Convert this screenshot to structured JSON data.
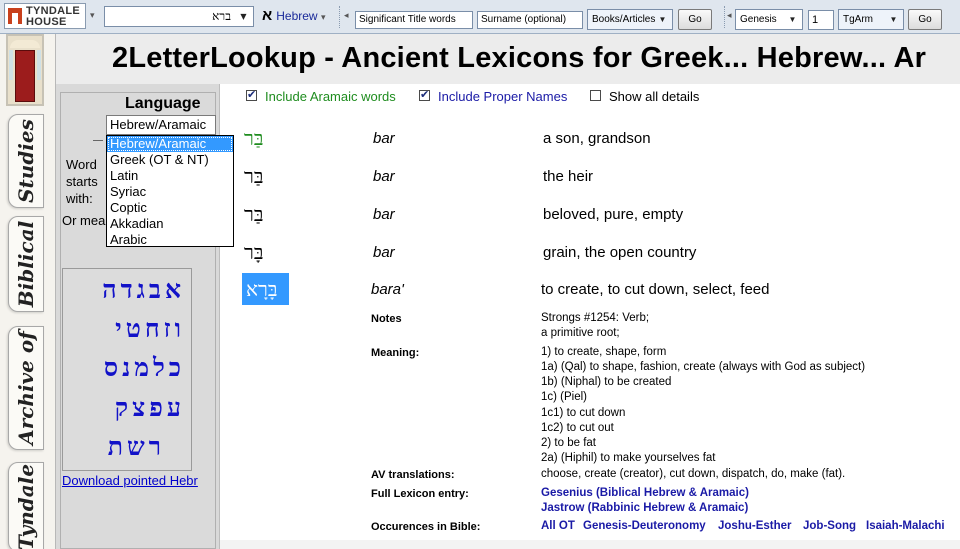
{
  "toolbar": {
    "logo_line1": "TYNDALE",
    "logo_line2": "HOUSE",
    "search_value": "ברא",
    "language_label": "Hebrew",
    "language_icon": "א",
    "title_words_placeholder": "Significant Title words",
    "surname_placeholder": "Surname (optional)",
    "books_select": "Books/Articles",
    "go_label": "Go",
    "book_select": "Genesis",
    "chapter_value": "1",
    "version_select": "TgArm",
    "go2_label": "Go"
  },
  "sidetabs": [
    "Studies",
    "Biblical",
    "Archive of",
    "Tyndale"
  ],
  "header": {
    "title": "2LetterLookup  -  Ancient Lexicons for Greek... Hebrew... Ar"
  },
  "leftpanel": {
    "language_label": "Language",
    "language_selected": "Hebrew/Aramaic",
    "language_options": [
      "Hebrew/Aramaic",
      "Greek (OT & NT)",
      "Latin",
      "Syriac",
      "Coptic",
      "Akkadian",
      "Arabic"
    ],
    "word_starts_line1": "Word",
    "word_starts_line2": "starts",
    "word_starts_line3": "with:",
    "or_means": "Or mea",
    "alefbet_rows": [
      "אבגדה",
      "וזחטי",
      "כלמנס",
      "עפצק",
      "רשת"
    ],
    "download_link": "Download pointed Hebr"
  },
  "options": {
    "aramaic_label": "Include Aramaic words",
    "aramaic_checked": true,
    "proper_names_label": "Include Proper Names",
    "proper_names_checked": true,
    "show_details_label": "Show all details",
    "show_details_checked": false
  },
  "entries": [
    {
      "hebrew": "בַּר",
      "translit": "bar",
      "gloss": "a son, grandson",
      "color": "#1e8c1e"
    },
    {
      "hebrew": "בַּר",
      "translit": "bar",
      "gloss": "the heir",
      "color": "#000000"
    },
    {
      "hebrew": "בַּר",
      "translit": "bar",
      "gloss": "beloved, pure, empty",
      "color": "#000000"
    },
    {
      "hebrew": "בָּר",
      "translit": "bar",
      "gloss": "grain, the open country",
      "color": "#000000"
    },
    {
      "hebrew": "בָּרָא",
      "translit": "bara'",
      "gloss": "to create, to cut down, select, feed",
      "color": "#ffffff"
    }
  ],
  "details": {
    "notes_label": "Notes",
    "notes": [
      "Strongs #1254: Verb;",
      "a primitive root;"
    ],
    "meaning_label": "Meaning:",
    "meaning": [
      "1) to create, shape, form",
      "1a) (Qal) to shape, fashion, create (always with God as subject)",
      "1b) (Niphal) to be created",
      "1c) (Piel)",
      "1c1) to cut down",
      "1c2) to cut out",
      "2) to be fat",
      "2a) (Hiphil) to make yourselves fat"
    ],
    "av_label": "AV translations:",
    "av": "choose, create (creator), cut down, dispatch, do, make (fat).",
    "lexicon_label": "Full Lexicon entry:",
    "lexicon_links": [
      "Gesenius (Biblical Hebrew & Aramaic)",
      "Jastrow (Rabbinic Hebrew & Aramaic)"
    ],
    "occurrences_label": "Occurences in Bible:",
    "occurrence_links": [
      "All OT",
      "Genesis-Deuteronomy",
      "Joshu-Esther",
      "Job-Song",
      "Isaiah-Malachi"
    ]
  },
  "colors": {
    "link": "#1a1aa6",
    "selection": "#3399ff",
    "aramaic_label": "#1e8c1e",
    "proper_names_label": "#1a1aa6",
    "alefbet": "#1212c8"
  }
}
